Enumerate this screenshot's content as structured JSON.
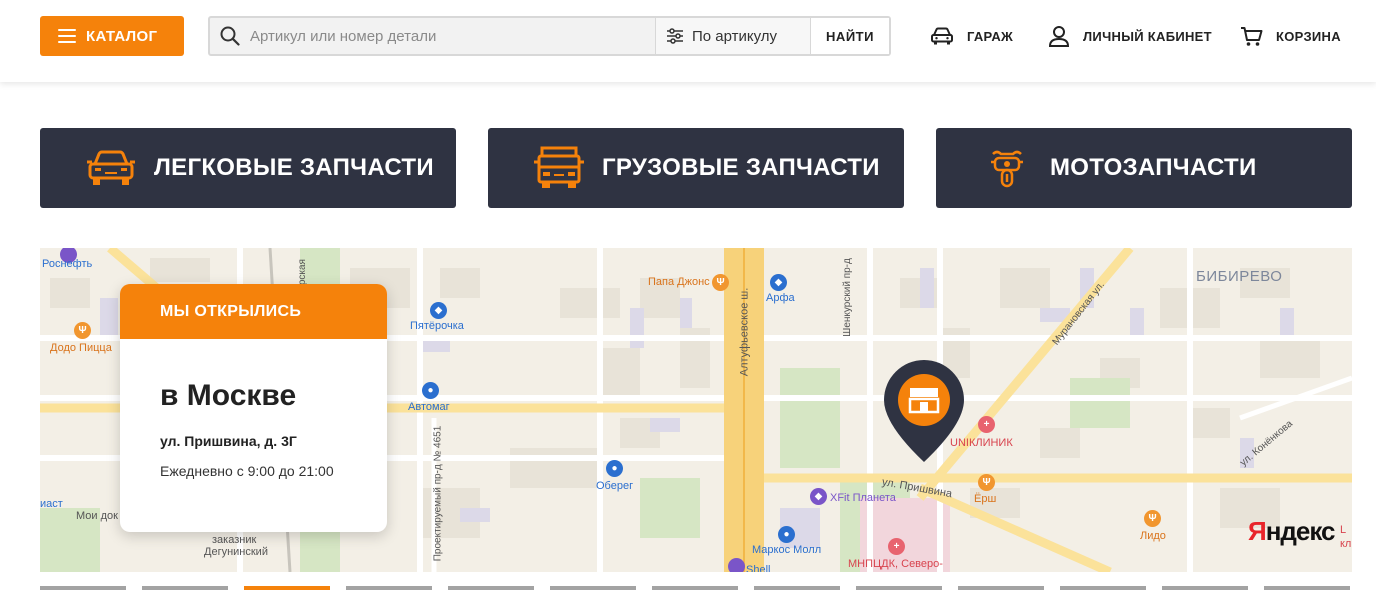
{
  "header": {
    "catalog_label": "КАТАЛОГ",
    "search_placeholder": "Артикул или номер детали",
    "search_mode": "По артикулу",
    "find_label": "НАЙТИ",
    "nav": {
      "garage": "ГАРАЖ",
      "account": "ЛИЧНЫЙ КАБИНЕТ",
      "cart": "КОРЗИНА"
    }
  },
  "categories": [
    {
      "label": "ЛЕГКОВЫЕ ЗАПЧАСТИ",
      "icon": "car-icon"
    },
    {
      "label": "ГРУЗОВЫЕ ЗАПЧАСТИ",
      "icon": "truck-icon"
    },
    {
      "label": "МОТОЗАПЧАСТИ",
      "icon": "motorcycle-icon"
    }
  ],
  "store_card": {
    "banner": "МЫ ОТКРЫЛИСЬ",
    "city": "в Москве",
    "address": "ул. Пришвина, д. 3Г",
    "hours": "Ежедневно с 9:00 до 21:00"
  },
  "map": {
    "labels": {
      "rosneft": "Роснефть",
      "dodo": "Додо Пицца",
      "pyaterochka": "Пятёрочка",
      "avtomag": "Автомаг",
      "papa_johns": "Папа Джонс",
      "arfa": "Арфа",
      "altufyevskoe": "Алтуфьевское ш.",
      "shenkursky": "Шенкурский пр-д",
      "bibirevo": "БИБИРЕВО",
      "muranovskaya": "Мурановская ул.",
      "uniklinik": "UNIКЛИНИК",
      "prishvina": "ул. Пришвина",
      "ersh": "Ёрш",
      "konenkova": "ул. Конёнкова",
      "xfit": "XFit Планета",
      "oberег": "Оберег",
      "proekt": "Проектируемый пр-д № 4651",
      "moi_dok": "Мои док",
      "iast": "иаст",
      "zakaznik": "заказник",
      "degunino": "Дегунинский",
      "markos": "Маркос Молл",
      "mnpcdk": "МНПЦДК, Северо-",
      "shell": "Shell",
      "lido": "Лидо",
      "yandex_prefix": "Я",
      "yandex_rest": "ндекс",
      "edge_l": "L",
      "edge_kl": "кл",
      "chirskaya": "чирская"
    }
  },
  "pager": {
    "count": 13,
    "active_index": 2
  },
  "colors": {
    "accent": "#f5820b",
    "dark_card": "#2f3342",
    "pin": "#2f3342"
  }
}
